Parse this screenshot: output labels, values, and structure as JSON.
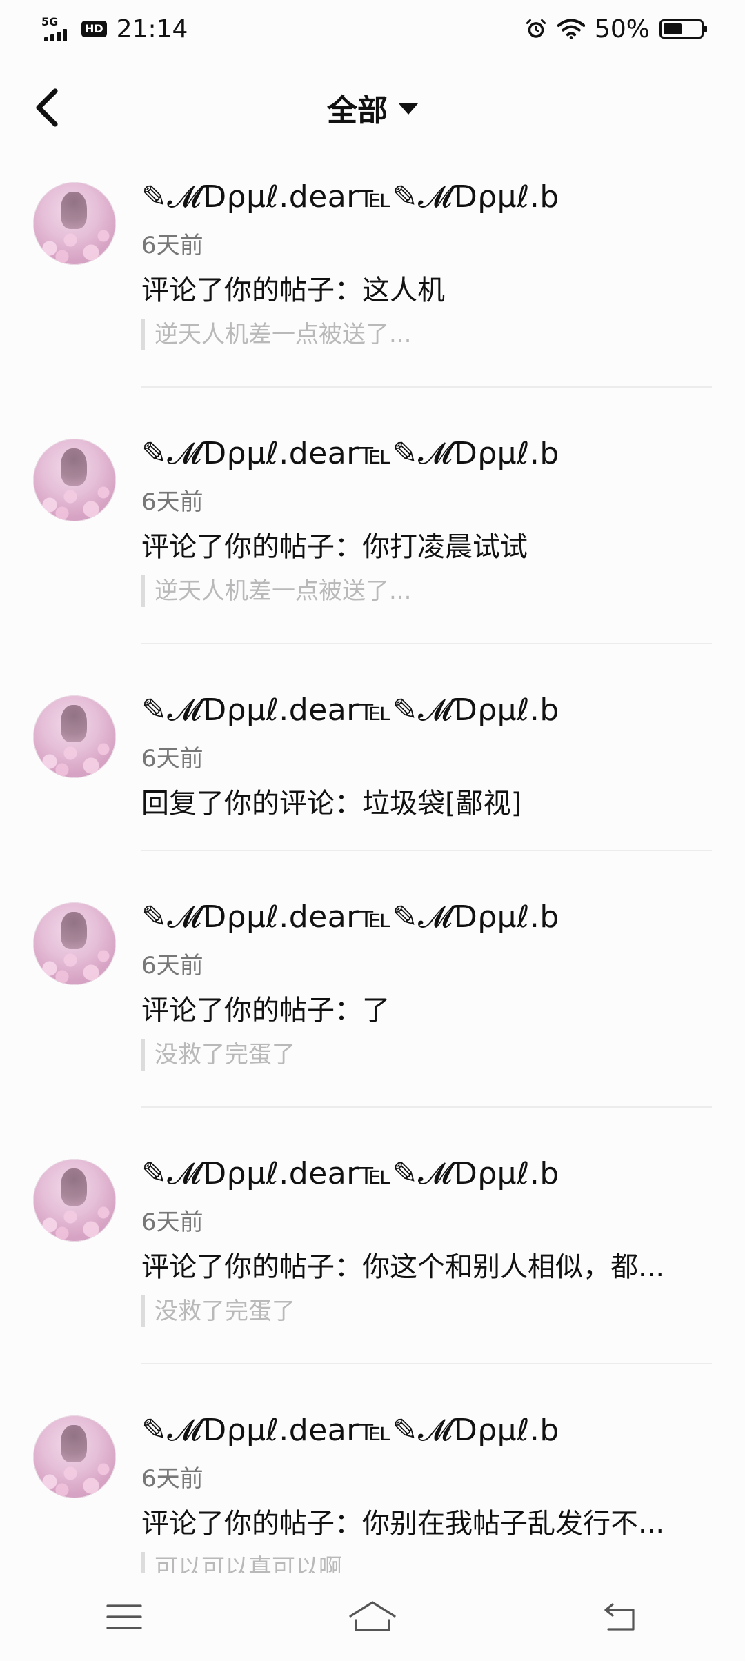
{
  "status_bar": {
    "network": "5G",
    "hd": "HD",
    "time": "21:14",
    "battery_percent": "50%",
    "battery_level": 0.5
  },
  "header": {
    "title": "全部"
  },
  "notifications": [
    {
      "user": "✎𝓜Ɗρµℓ.dear℡✎𝓜Ɗρµℓ.b",
      "time": "6天前",
      "action": "评论了你的帖子：这人机",
      "quote": "逆天人机差一点被送了..."
    },
    {
      "user": "✎𝓜Ɗρµℓ.dear℡✎𝓜Ɗρµℓ.b",
      "time": "6天前",
      "action": "评论了你的帖子：你打凌晨试试",
      "quote": "逆天人机差一点被送了..."
    },
    {
      "user": "✎𝓜Ɗρµℓ.dear℡✎𝓜Ɗρµℓ.b",
      "time": "6天前",
      "action": "回复了你的评论：垃圾袋[鄙视]",
      "quote": ""
    },
    {
      "user": "✎𝓜Ɗρµℓ.dear℡✎𝓜Ɗρµℓ.b",
      "time": "6天前",
      "action": "评论了你的帖子：了",
      "quote": "没救了完蛋了"
    },
    {
      "user": "✎𝓜Ɗρµℓ.dear℡✎𝓜Ɗρµℓ.b",
      "time": "6天前",
      "action": "评论了你的帖子：你这个和别人相似，都...",
      "quote": "没救了完蛋了"
    },
    {
      "user": "✎𝓜Ɗρµℓ.dear℡✎𝓜Ɗρµℓ.b",
      "time": "6天前",
      "action": "评论了你的帖子：你别在我帖子乱发行不...",
      "quote": "可以可以真可以啊"
    }
  ]
}
